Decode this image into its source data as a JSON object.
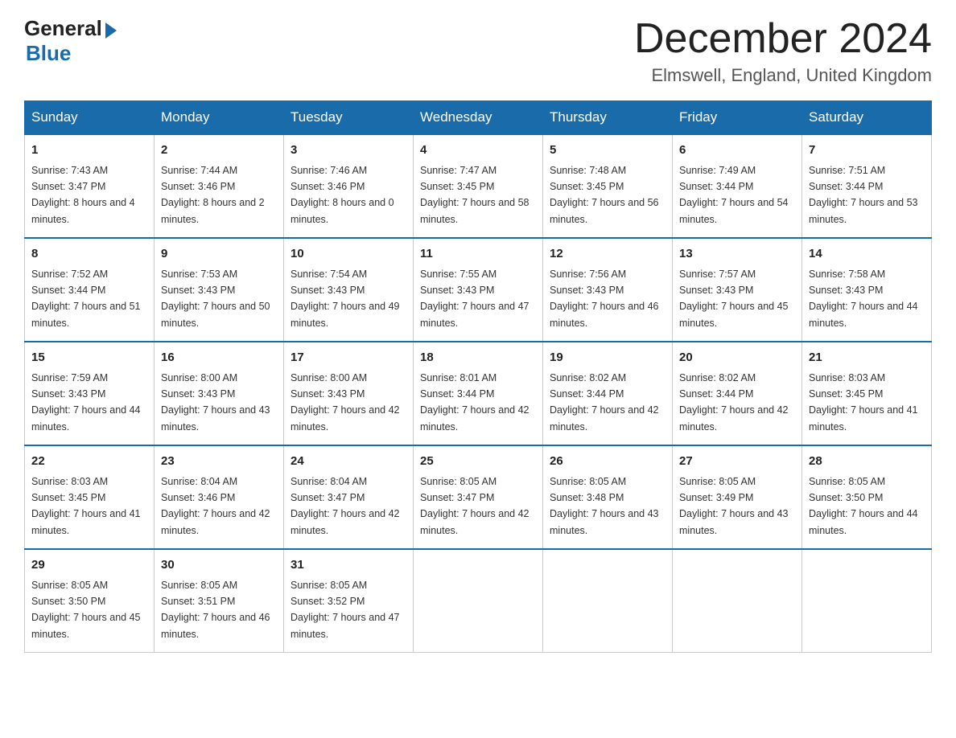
{
  "header": {
    "logo_general": "General",
    "logo_blue": "Blue",
    "month_title": "December 2024",
    "subtitle": "Elmswell, England, United Kingdom"
  },
  "weekdays": [
    "Sunday",
    "Monday",
    "Tuesday",
    "Wednesday",
    "Thursday",
    "Friday",
    "Saturday"
  ],
  "weeks": [
    [
      {
        "day": "1",
        "sunrise": "7:43 AM",
        "sunset": "3:47 PM",
        "daylight": "8 hours and 4 minutes."
      },
      {
        "day": "2",
        "sunrise": "7:44 AM",
        "sunset": "3:46 PM",
        "daylight": "8 hours and 2 minutes."
      },
      {
        "day": "3",
        "sunrise": "7:46 AM",
        "sunset": "3:46 PM",
        "daylight": "8 hours and 0 minutes."
      },
      {
        "day": "4",
        "sunrise": "7:47 AM",
        "sunset": "3:45 PM",
        "daylight": "7 hours and 58 minutes."
      },
      {
        "day": "5",
        "sunrise": "7:48 AM",
        "sunset": "3:45 PM",
        "daylight": "7 hours and 56 minutes."
      },
      {
        "day": "6",
        "sunrise": "7:49 AM",
        "sunset": "3:44 PM",
        "daylight": "7 hours and 54 minutes."
      },
      {
        "day": "7",
        "sunrise": "7:51 AM",
        "sunset": "3:44 PM",
        "daylight": "7 hours and 53 minutes."
      }
    ],
    [
      {
        "day": "8",
        "sunrise": "7:52 AM",
        "sunset": "3:44 PM",
        "daylight": "7 hours and 51 minutes."
      },
      {
        "day": "9",
        "sunrise": "7:53 AM",
        "sunset": "3:43 PM",
        "daylight": "7 hours and 50 minutes."
      },
      {
        "day": "10",
        "sunrise": "7:54 AM",
        "sunset": "3:43 PM",
        "daylight": "7 hours and 49 minutes."
      },
      {
        "day": "11",
        "sunrise": "7:55 AM",
        "sunset": "3:43 PM",
        "daylight": "7 hours and 47 minutes."
      },
      {
        "day": "12",
        "sunrise": "7:56 AM",
        "sunset": "3:43 PM",
        "daylight": "7 hours and 46 minutes."
      },
      {
        "day": "13",
        "sunrise": "7:57 AM",
        "sunset": "3:43 PM",
        "daylight": "7 hours and 45 minutes."
      },
      {
        "day": "14",
        "sunrise": "7:58 AM",
        "sunset": "3:43 PM",
        "daylight": "7 hours and 44 minutes."
      }
    ],
    [
      {
        "day": "15",
        "sunrise": "7:59 AM",
        "sunset": "3:43 PM",
        "daylight": "7 hours and 44 minutes."
      },
      {
        "day": "16",
        "sunrise": "8:00 AM",
        "sunset": "3:43 PM",
        "daylight": "7 hours and 43 minutes."
      },
      {
        "day": "17",
        "sunrise": "8:00 AM",
        "sunset": "3:43 PM",
        "daylight": "7 hours and 42 minutes."
      },
      {
        "day": "18",
        "sunrise": "8:01 AM",
        "sunset": "3:44 PM",
        "daylight": "7 hours and 42 minutes."
      },
      {
        "day": "19",
        "sunrise": "8:02 AM",
        "sunset": "3:44 PM",
        "daylight": "7 hours and 42 minutes."
      },
      {
        "day": "20",
        "sunrise": "8:02 AM",
        "sunset": "3:44 PM",
        "daylight": "7 hours and 42 minutes."
      },
      {
        "day": "21",
        "sunrise": "8:03 AM",
        "sunset": "3:45 PM",
        "daylight": "7 hours and 41 minutes."
      }
    ],
    [
      {
        "day": "22",
        "sunrise": "8:03 AM",
        "sunset": "3:45 PM",
        "daylight": "7 hours and 41 minutes."
      },
      {
        "day": "23",
        "sunrise": "8:04 AM",
        "sunset": "3:46 PM",
        "daylight": "7 hours and 42 minutes."
      },
      {
        "day": "24",
        "sunrise": "8:04 AM",
        "sunset": "3:47 PM",
        "daylight": "7 hours and 42 minutes."
      },
      {
        "day": "25",
        "sunrise": "8:05 AM",
        "sunset": "3:47 PM",
        "daylight": "7 hours and 42 minutes."
      },
      {
        "day": "26",
        "sunrise": "8:05 AM",
        "sunset": "3:48 PM",
        "daylight": "7 hours and 43 minutes."
      },
      {
        "day": "27",
        "sunrise": "8:05 AM",
        "sunset": "3:49 PM",
        "daylight": "7 hours and 43 minutes."
      },
      {
        "day": "28",
        "sunrise": "8:05 AM",
        "sunset": "3:50 PM",
        "daylight": "7 hours and 44 minutes."
      }
    ],
    [
      {
        "day": "29",
        "sunrise": "8:05 AM",
        "sunset": "3:50 PM",
        "daylight": "7 hours and 45 minutes."
      },
      {
        "day": "30",
        "sunrise": "8:05 AM",
        "sunset": "3:51 PM",
        "daylight": "7 hours and 46 minutes."
      },
      {
        "day": "31",
        "sunrise": "8:05 AM",
        "sunset": "3:52 PM",
        "daylight": "7 hours and 47 minutes."
      },
      null,
      null,
      null,
      null
    ]
  ]
}
